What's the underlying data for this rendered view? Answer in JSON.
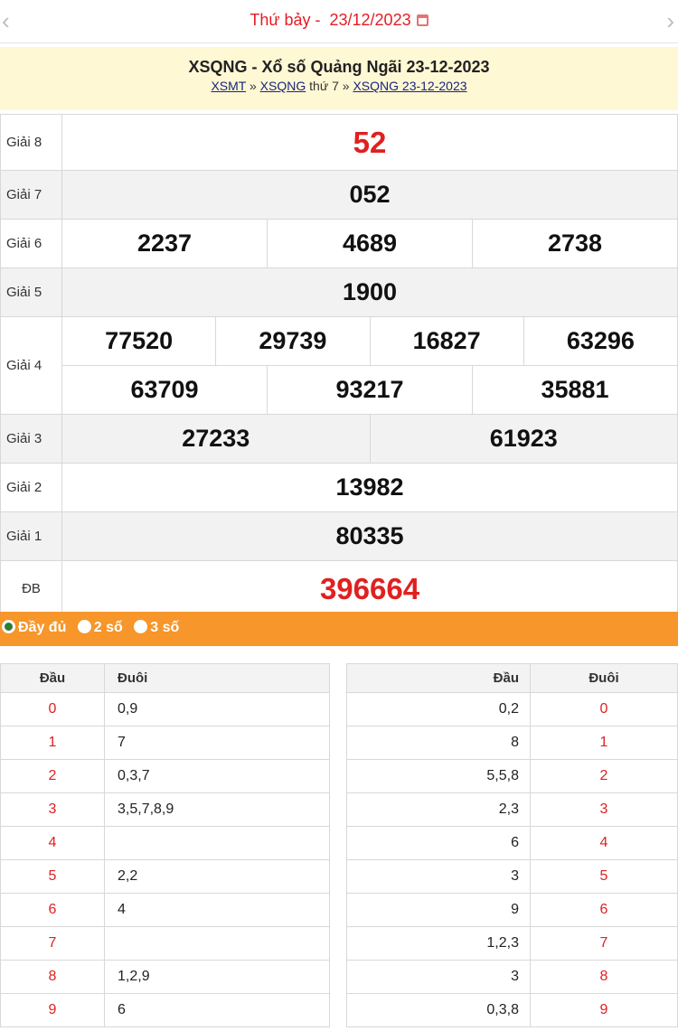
{
  "nav": {
    "prev_glyph": "‹",
    "next_glyph": "›",
    "day_label": "Thứ bảy -",
    "date_label": "23/12/2023"
  },
  "header": {
    "title": "XSQNG - Xổ số Quảng Ngãi 23-12-2023",
    "crumbs": {
      "link1": "XSMT",
      "sep1": "»",
      "link2": "XSQNG",
      "text2": "thứ 7",
      "sep2": "»",
      "link3": "XSQNG 23-12-2023"
    }
  },
  "results": {
    "g8": {
      "label": "Giải 8",
      "values": [
        "52"
      ]
    },
    "g7": {
      "label": "Giải 7",
      "values": [
        "052"
      ]
    },
    "g6": {
      "label": "Giải 6",
      "values": [
        "2237",
        "4689",
        "2738"
      ]
    },
    "g5": {
      "label": "Giải 5",
      "values": [
        "1900"
      ]
    },
    "g4": {
      "label": "Giải 4",
      "values": [
        "77520",
        "29739",
        "16827",
        "63296",
        "63709",
        "93217",
        "35881"
      ]
    },
    "g3": {
      "label": "Giải 3",
      "values": [
        "27233",
        "61923"
      ]
    },
    "g2": {
      "label": "Giải 2",
      "values": [
        "13982"
      ]
    },
    "g1": {
      "label": "Giải 1",
      "values": [
        "80335"
      ]
    },
    "db": {
      "label": "ĐB",
      "values": [
        "396664"
      ]
    }
  },
  "options": [
    {
      "label": "Đầy đủ",
      "selected": true
    },
    {
      "label": "2 số",
      "selected": false
    },
    {
      "label": "3 số",
      "selected": false
    }
  ],
  "dau_table": {
    "headers": [
      "Đầu",
      "Đuôi"
    ],
    "rows": [
      {
        "digit": "0",
        "values": "0,9"
      },
      {
        "digit": "1",
        "values": "7"
      },
      {
        "digit": "2",
        "values": "0,3,7"
      },
      {
        "digit": "3",
        "values": "3,5,7,8,9"
      },
      {
        "digit": "4",
        "values": ""
      },
      {
        "digit": "5",
        "values": "2,2"
      },
      {
        "digit": "6",
        "values": "4"
      },
      {
        "digit": "7",
        "values": ""
      },
      {
        "digit": "8",
        "values": "1,2,9"
      },
      {
        "digit": "9",
        "values": "6"
      }
    ]
  },
  "duoi_table": {
    "headers": [
      "Đầu",
      "Đuôi"
    ],
    "rows": [
      {
        "values": "0,2",
        "digit": "0"
      },
      {
        "values": "8",
        "digit": "1"
      },
      {
        "values": "5,5,8",
        "digit": "2"
      },
      {
        "values": "2,3",
        "digit": "3"
      },
      {
        "values": "6",
        "digit": "4"
      },
      {
        "values": "3",
        "digit": "5"
      },
      {
        "values": "9",
        "digit": "6"
      },
      {
        "values": "1,2,3",
        "digit": "7"
      },
      {
        "values": "3",
        "digit": "8"
      },
      {
        "values": "0,3,8",
        "digit": "9"
      }
    ]
  },
  "colors": {
    "accent_red": "#e02020",
    "orange_bar": "#f6962b",
    "title_band": "#fff8d5",
    "row_gray": "#f2f2f2"
  }
}
